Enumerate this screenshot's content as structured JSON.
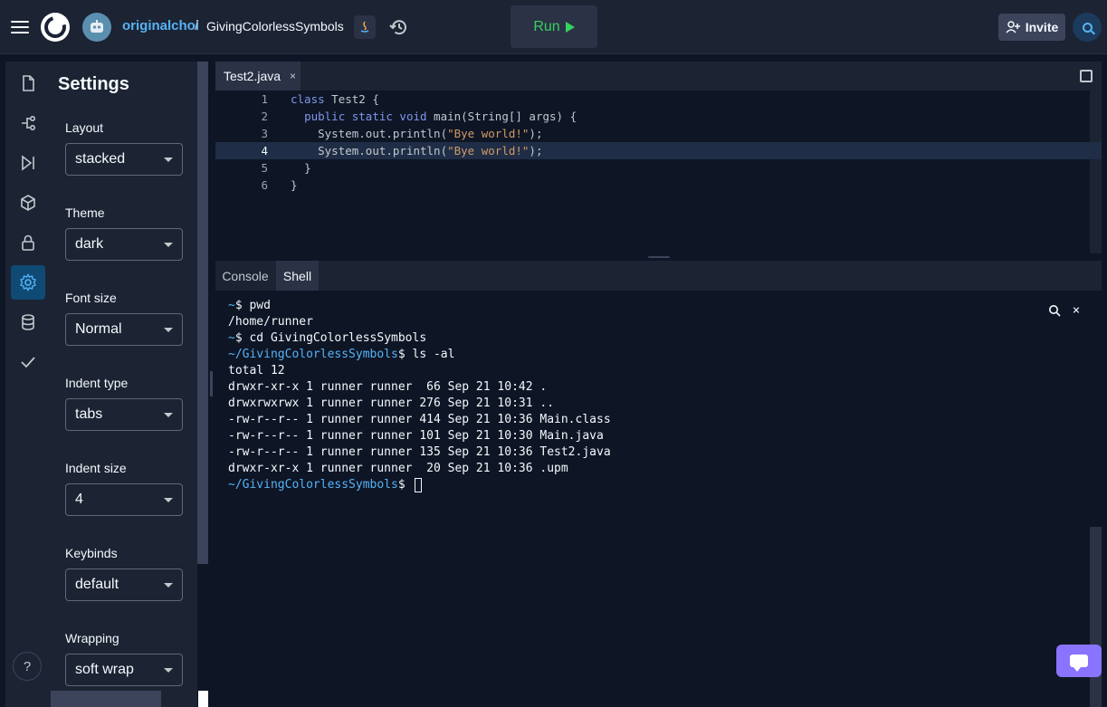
{
  "header": {
    "owner": "originalchoi",
    "separator": "/",
    "repl_name": "GivingColorlessSymbols",
    "run_label": "Run",
    "invite_label": "Invite",
    "icons": [
      "menu-icon",
      "replit-logo",
      "avatar",
      "java-icon",
      "history-icon",
      "play-icon",
      "add-user-icon",
      "search-icon"
    ]
  },
  "rail": {
    "items": [
      "files-icon",
      "git-icon",
      "debugger-icon",
      "packages-icon",
      "secrets-icon",
      "settings-icon",
      "database-icon",
      "check-icon"
    ],
    "active": "settings-icon",
    "help_label": "?"
  },
  "settings": {
    "title": "Settings",
    "fields": [
      {
        "label": "Layout",
        "value": "stacked"
      },
      {
        "label": "Theme",
        "value": "dark"
      },
      {
        "label": "Font size",
        "value": "Normal"
      },
      {
        "label": "Indent type",
        "value": "tabs"
      },
      {
        "label": "Indent size",
        "value": "4"
      },
      {
        "label": "Keybinds",
        "value": "default"
      },
      {
        "label": "Wrapping",
        "value": "soft wrap"
      }
    ]
  },
  "editor": {
    "tab_label": "Test2.java",
    "tab_close": "×",
    "highlighted_line": 4,
    "lines": [
      {
        "n": "1",
        "indent": "",
        "kw": "class",
        "rest": " Test2 {",
        "str": "",
        "tail": ""
      },
      {
        "n": "2",
        "indent": "  ",
        "kw": "public static void",
        "rest": " main(String[] args) {",
        "str": "",
        "tail": ""
      },
      {
        "n": "3",
        "indent": "    ",
        "kw": "",
        "rest": "System.out.println(",
        "str": "\"Bye world!\"",
        "tail": ");"
      },
      {
        "n": "4",
        "indent": "    ",
        "kw": "",
        "rest": "System.out.println(",
        "str": "\"Bye world!\"",
        "tail": ");"
      },
      {
        "n": "5",
        "indent": "  ",
        "kw": "",
        "rest": "}",
        "str": "",
        "tail": ""
      },
      {
        "n": "6",
        "indent": "",
        "kw": "",
        "rest": "}",
        "str": "",
        "tail": ""
      }
    ]
  },
  "console": {
    "tabs": [
      "Console",
      "Shell"
    ],
    "active_tab": "Shell",
    "lines": [
      {
        "prompt": "~",
        "text": "$ pwd"
      },
      {
        "prompt": "",
        "text": "/home/runner"
      },
      {
        "prompt": "~",
        "text": "$ cd GivingColorlessSymbols"
      },
      {
        "prompt": "~/GivingColorlessSymbols",
        "text": "$ ls -al"
      },
      {
        "prompt": "",
        "text": "total 12"
      },
      {
        "prompt": "",
        "text": "drwxr-xr-x 1 runner runner  66 Sep 21 10:42 ."
      },
      {
        "prompt": "",
        "text": "drwxrwxrwx 1 runner runner 276 Sep 21 10:31 .."
      },
      {
        "prompt": "",
        "text": "-rw-r--r-- 1 runner runner 414 Sep 21 10:36 Main.class"
      },
      {
        "prompt": "",
        "text": "-rw-r--r-- 1 runner runner 101 Sep 21 10:30 Main.java"
      },
      {
        "prompt": "",
        "text": "-rw-r--r-- 1 runner runner 135 Sep 21 10:36 Test2.java"
      },
      {
        "prompt": "",
        "text": "drwxr-xr-x 1 runner runner  20 Sep 21 10:36 .upm"
      },
      {
        "prompt": "~/GivingColorlessSymbols",
        "text": "$ "
      }
    ],
    "close_label": "×"
  },
  "colors": {
    "accent": "#56b3f5",
    "run_green": "#36d15e",
    "chat_purple": "#8a73ff",
    "active_rail": "#0f4a75"
  }
}
